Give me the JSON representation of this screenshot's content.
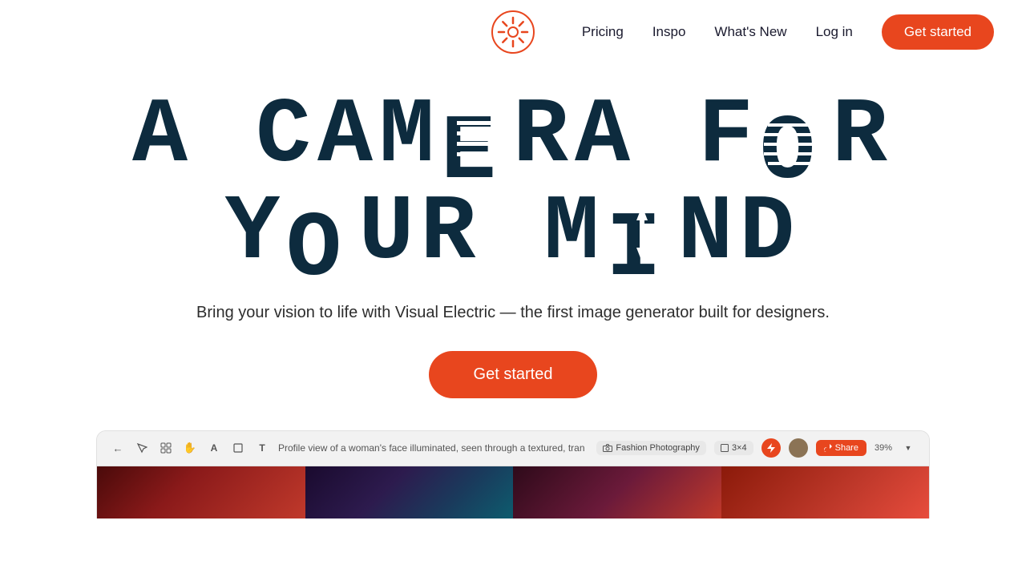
{
  "nav": {
    "logo_alt": "Visual Electric logo",
    "links": [
      {
        "label": "Pricing",
        "id": "pricing"
      },
      {
        "label": "Inspo",
        "id": "inspo"
      },
      {
        "label": "What's New",
        "id": "whats-new"
      },
      {
        "label": "Log in",
        "id": "login"
      }
    ],
    "cta_label": "Get started"
  },
  "hero": {
    "headline_line1": "A CAMERA FOR",
    "headline_line2": "YOUR MIND",
    "subtext": "Bring your vision to life with Visual Electric — the first\nimage generator built for designers.",
    "cta_label": "Get started"
  },
  "app_preview": {
    "toolbar": {
      "prompt": "Profile view of a woman's face illuminated, seen through a textured, tran",
      "style_badge": "Fashion Photography",
      "grid_badge": "3×4",
      "share_label": "Share",
      "zoom": "39%"
    }
  },
  "colors": {
    "brand_orange": "#e8461e",
    "headline_dark": "#0d2b3e",
    "nav_text": "#1a1a2e"
  }
}
